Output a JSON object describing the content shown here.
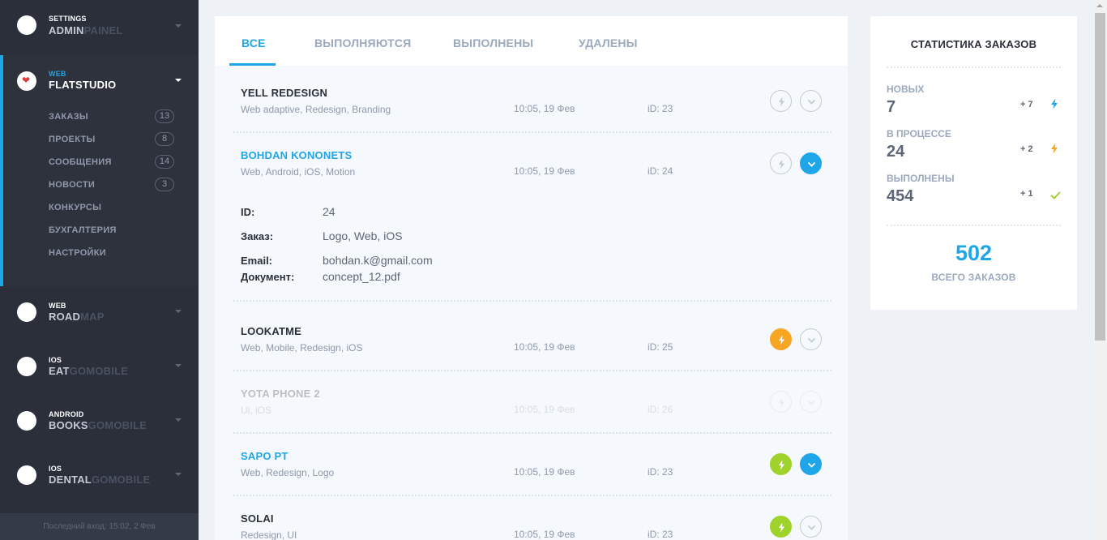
{
  "sidebar": {
    "projects": [
      {
        "small": "SETTINGS",
        "big1": "ADMIN",
        "big2": "PAINEL"
      },
      {
        "small": "WEB",
        "big1": "FLATSTUDIO",
        "big2": ""
      },
      {
        "small": "WEB",
        "big1": "ROAD",
        "big2": "MAP"
      },
      {
        "small": "IOS",
        "big1": "EAT",
        "big2": "GOMOBILE"
      },
      {
        "small": "ANDROID",
        "big1": "BOOKS",
        "big2": "GOMOBILE"
      },
      {
        "small": "IOS",
        "big1": "DENTAL",
        "big2": "GOMOBILE"
      }
    ],
    "menu": [
      {
        "label": "ЗАКАЗЫ",
        "count": "13"
      },
      {
        "label": "ПРОЕКТЫ",
        "count": "8"
      },
      {
        "label": "СООБЩЕНИЯ",
        "count": "14"
      },
      {
        "label": "НОВОСТИ",
        "count": "3"
      },
      {
        "label": "КОНКУРСЫ",
        "count": ""
      },
      {
        "label": "БУХГАЛТЕРИЯ",
        "count": ""
      },
      {
        "label": "НАСТРОЙКИ",
        "count": ""
      }
    ],
    "last_login": "Последний вход: 15:02, 2 Фев"
  },
  "tabs": [
    "ВСЕ",
    "ВЫПОЛНЯЮТСЯ",
    "ВЫПОЛНЕНЫ",
    "УДАЛЕНЫ"
  ],
  "orders": [
    {
      "title": "YELL REDESIGN",
      "tags": "Web adaptive, Redesign, Branding",
      "time": "10:05, 19 Фев",
      "id": "iD: 23"
    },
    {
      "title": "BOHDAN KONONETS",
      "tags": "Web, Android, iOS, Motion",
      "time": "10:05, 19 Фев",
      "id": "iD: 24"
    },
    {
      "title": "LOOKATME",
      "tags": "Web, Mobile, Redesign, iOS",
      "time": "10:05, 19 Фев",
      "id": "iD: 25"
    },
    {
      "title": "YOTA PHONE 2",
      "tags": "Ui, iOS",
      "time": "10:05, 19 Фев",
      "id": "iD: 26"
    },
    {
      "title": "SAPO PT",
      "tags": "Web, Redesign, Logo",
      "time": "10:05, 19 Фев",
      "id": "iD: 23"
    },
    {
      "title": "SOLAI",
      "tags": "Redesign, UI",
      "time": "10:05, 19 Фев",
      "id": "iD: 23"
    }
  ],
  "details": {
    "id_label": "ID:",
    "id_value": "24",
    "order_label": "Заказ:",
    "order_value": "Logo, Web, iOS",
    "email_label": "Email:",
    "email_value": "bohdan.k@gmail.com",
    "doc_label": "Документ:",
    "doc_value": "concept_12.pdf"
  },
  "stats": {
    "title": "СТАТИСТИКА ЗАКАЗОВ",
    "rows": [
      {
        "label": "НОВЫХ",
        "value": "7",
        "delta": "+ 7",
        "icon": "bolt-icon",
        "color": "#1fa6e8"
      },
      {
        "label": "В ПРОЦЕССЕ",
        "value": "24",
        "delta": "+ 2",
        "icon": "bolt-icon",
        "color": "#f6a623"
      },
      {
        "label": "ВЫПОЛНЕНЫ",
        "value": "454",
        "delta": "+ 1",
        "icon": "check-icon",
        "color": "#9fd32b"
      }
    ],
    "total_value": "502",
    "total_label": "ВСЕГО ЗАКАЗОВ"
  },
  "colors": {
    "accent": "#1fa6e8",
    "orange": "#f6a623",
    "green": "#9fd32b",
    "sidebar_bg": "#2a2f3a"
  }
}
